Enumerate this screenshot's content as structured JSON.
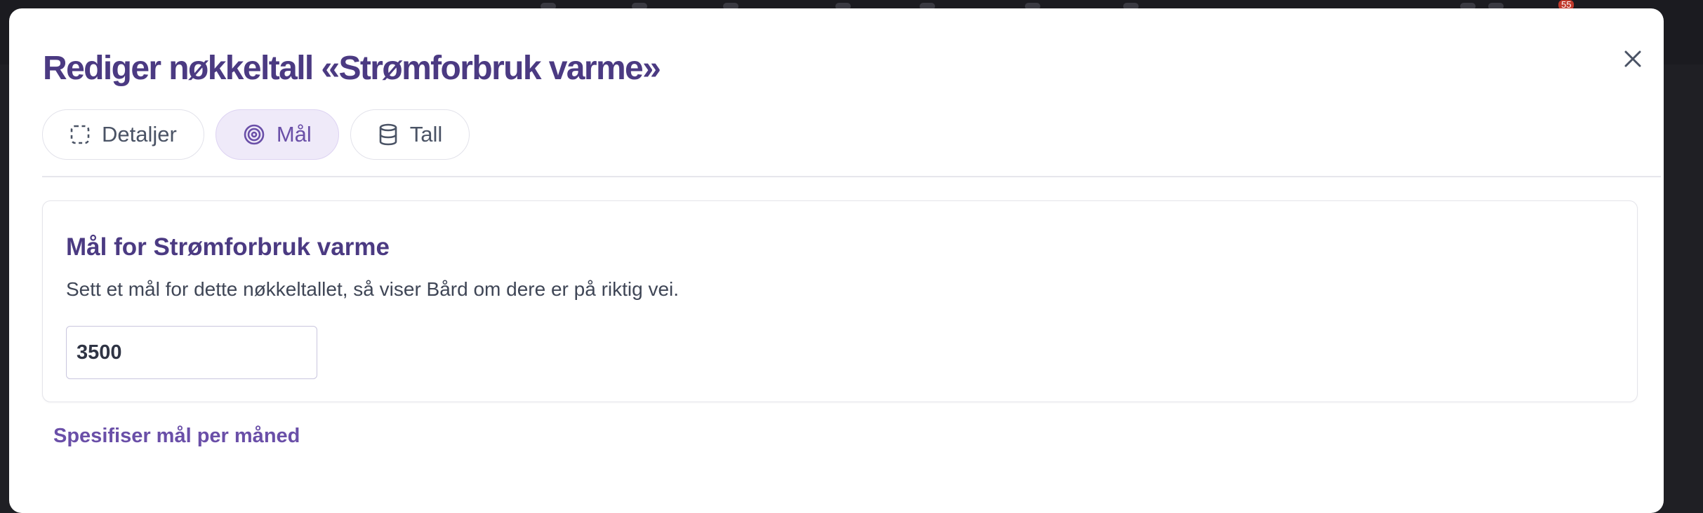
{
  "dialog": {
    "title": "Rediger nøkkeltall «Strømforbruk varme»"
  },
  "tabs": [
    {
      "label": "Detaljer",
      "icon": "dashed-square-icon",
      "active": false
    },
    {
      "label": "Mål",
      "icon": "target-icon",
      "active": true
    },
    {
      "label": "Tall",
      "icon": "database-icon",
      "active": false
    }
  ],
  "goal_card": {
    "title": "Mål for Strømforbruk varme",
    "description": "Sett et mål for dette nøkkeltallet, så viser Bård om dere er på riktig vei.",
    "input_value": "3500"
  },
  "month_link": "Spesifiser mål per måned",
  "background": {
    "notification_count": "55"
  },
  "colors": {
    "accent": "#4b3a82",
    "active_tab_bg": "#efeaf9",
    "link": "#6a4fa8"
  }
}
